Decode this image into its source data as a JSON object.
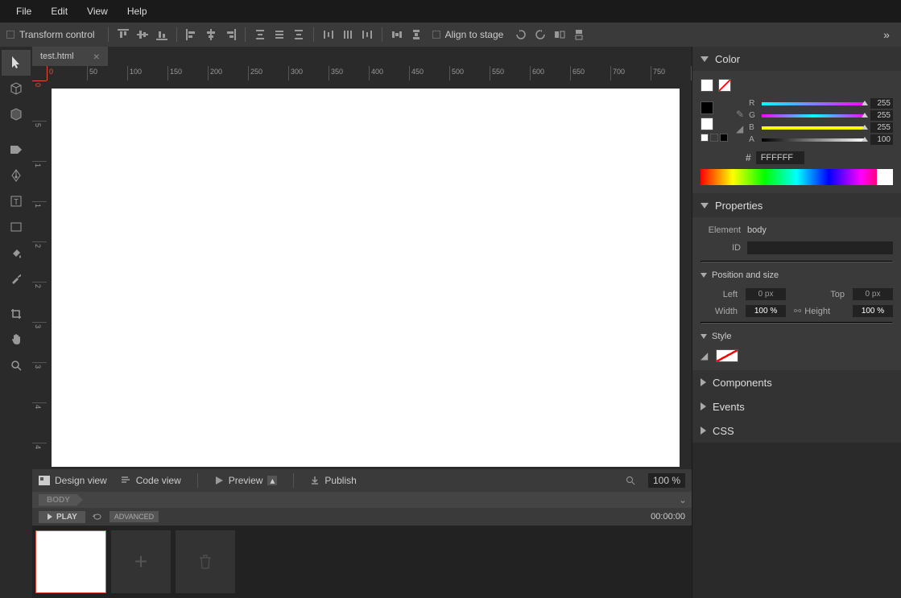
{
  "menu": {
    "file": "File",
    "edit": "Edit",
    "view": "View",
    "help": "Help"
  },
  "toolbar": {
    "transform": "Transform control",
    "align_stage": "Align to stage"
  },
  "tab": {
    "filename": "test.html"
  },
  "zoom": "100 %",
  "bottom": {
    "design": "Design view",
    "code": "Code view",
    "preview": "Preview",
    "publish": "Publish"
  },
  "breadcrumb": "BODY",
  "timeline": {
    "play": "PLAY",
    "advanced": "ADVANCED",
    "time": "00:00:00"
  },
  "panels": {
    "color": "Color",
    "properties": "Properties",
    "components": "Components",
    "events": "Events",
    "css": "CSS"
  },
  "color": {
    "r": "255",
    "g": "255",
    "b": "255",
    "a": "100",
    "r_label": "R",
    "g_label": "G",
    "b_label": "B",
    "a_label": "A",
    "hex_label": "#",
    "hex": "FFFFFF"
  },
  "props": {
    "element_label": "Element",
    "element": "body",
    "id_label": "ID",
    "id": "",
    "pos_section": "Position and size",
    "left_label": "Left",
    "left": "0 px",
    "top_label": "Top",
    "top": "0 px",
    "width_label": "Width",
    "width": "100 %",
    "height_label": "Height",
    "height": "100 %",
    "style_section": "Style"
  }
}
